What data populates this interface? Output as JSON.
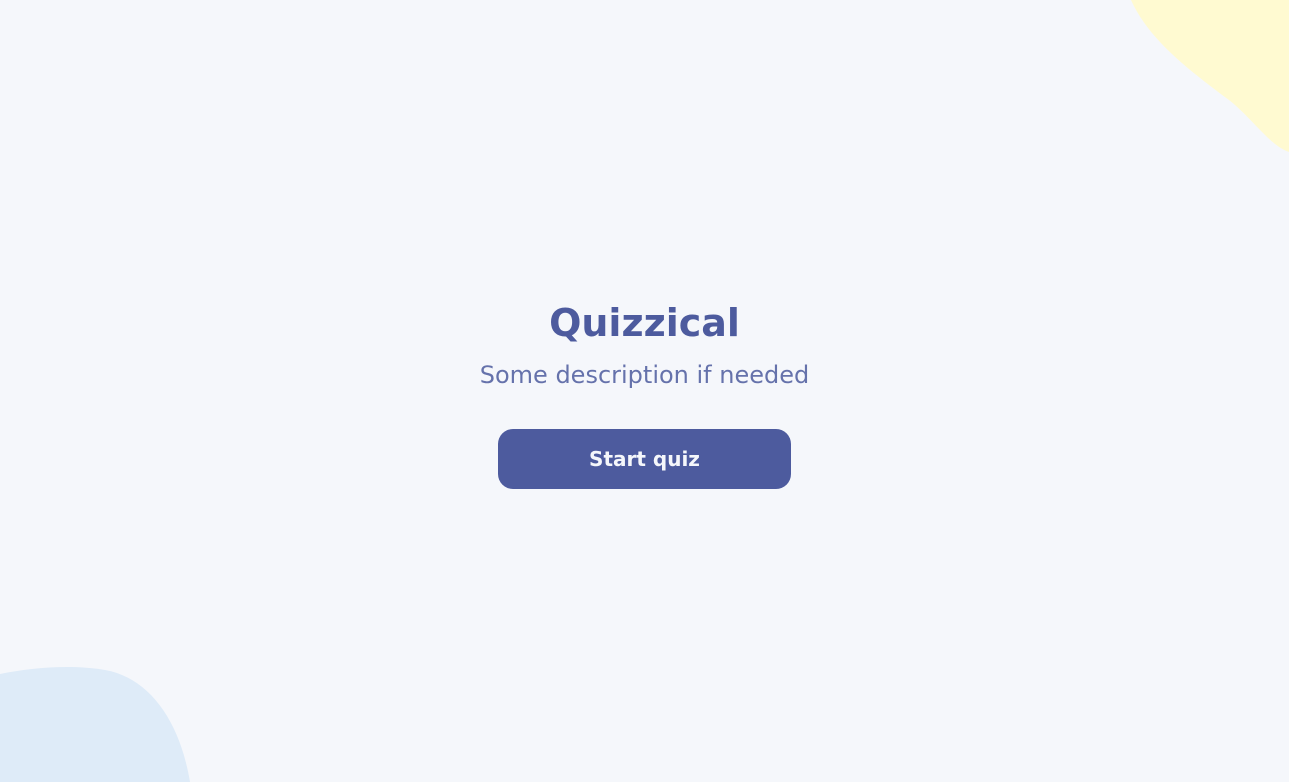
{
  "app": {
    "title": "Quizzical",
    "description": "Some description if needed"
  },
  "actions": {
    "start_label": "Start quiz"
  },
  "colors": {
    "background": "#F5F7FB",
    "primary": "#4D5B9E",
    "heading": "#293264",
    "blob_yellow": "#FFFAD1",
    "blob_blue": "#DEEBF8"
  }
}
